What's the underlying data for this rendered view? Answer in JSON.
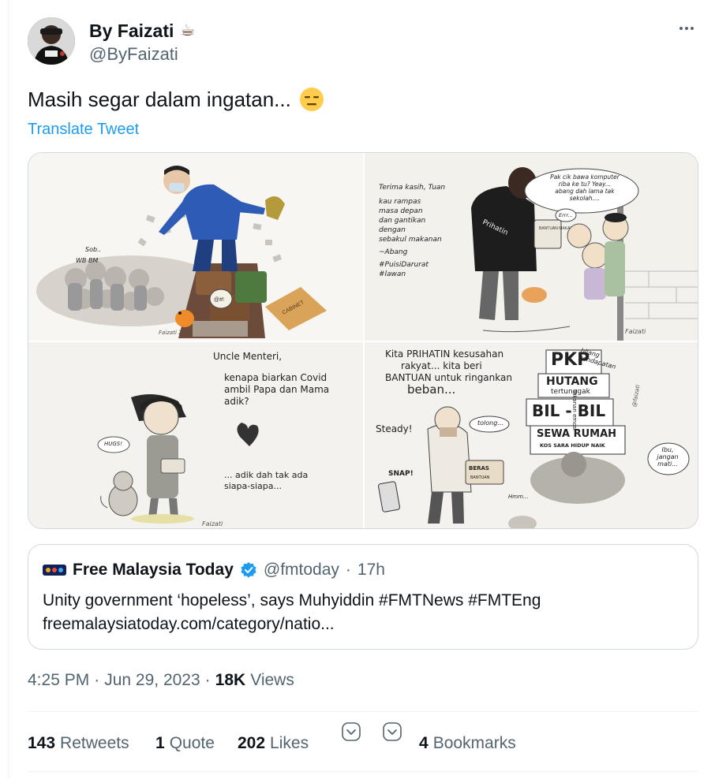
{
  "author": {
    "display_name": "By Faizati",
    "name_emoji": "☕",
    "handle": "@ByFaizati"
  },
  "tweet": {
    "text": "Masih segar dalam ingatan...",
    "emoji": "😑",
    "translate_label": "Translate Tweet"
  },
  "comics": {
    "panel1": {
      "caption_left": "Sob..",
      "caption_left2": "WB BM",
      "sound": "@#!",
      "box1": "CABINET",
      "box2": "MENI PERMINTAAN",
      "signature": "Faizati 2021"
    },
    "panel2": {
      "poem": [
        "Terima kasih, Tuan",
        "kau rampas",
        "masa depan",
        "dan gantikan",
        "dengan",
        "sebakul makanan"
      ],
      "author": "~Abang",
      "hashtags": [
        "#PuisiDarurat",
        "#lawan"
      ],
      "bubble": [
        "Pak cik bawa komputer",
        "riba ke tu? Yeay...",
        "abang dah lama tak",
        "sekolah...."
      ],
      "err": "Errr...",
      "vest": "Prihatin",
      "bag": "BANTUAN MAKANAN",
      "signature": "Faizati"
    },
    "panel3": {
      "lines": [
        "Uncle Menteri,",
        "kenapa biarkan Covid",
        "ambil Papa dan Mama",
        "adik?"
      ],
      "bottom": [
        "... adik dah tak ada",
        "siapa-siapa..."
      ],
      "hugs": "HUGS!",
      "signature": "Faizati"
    },
    "panel4": {
      "top": [
        "Kita PRIHATIN kesusahan",
        "rakyat... kita beri",
        "BANTUAN untuk ringankan",
        "beban..."
      ],
      "steady": "Steady!",
      "tolong": "tolong...",
      "pkp": "PKP",
      "pkp_note": [
        "hilang",
        "pendapatan"
      ],
      "hutang": "HUTANG",
      "hutang_note": "tertunggak",
      "bil": "BIL - BIL",
      "sewa": "SEWA RUMAH",
      "kos": "KOS SARA HIDUP NAIK",
      "emosi": "Tekanan emosi",
      "ibu": [
        "Ibu,",
        "jangan",
        "mati..."
      ],
      "snap": "SNAP!",
      "beras": "BERAS",
      "bantuan": "BANTUAN",
      "hmm": "Hmm...",
      "signature": "@faizati"
    }
  },
  "quote": {
    "name": "Free Malaysia Today",
    "handle": "@fmtoday",
    "separator": "·",
    "time": "17h",
    "text": "Unity government ‘hopeless’, says Muhyiddin #FMTNews #FMTEng",
    "link": "freemalaysiatoday.com/category/natio..."
  },
  "meta": {
    "time": "4:25 PM",
    "sep1": "·",
    "date": "Jun 29, 2023",
    "sep2": "·",
    "views_count": "18K",
    "views_label": "Views"
  },
  "stats": {
    "retweets_count": "143",
    "retweets_label": "Retweets",
    "quotes_count": "1",
    "quotes_label": "Quote",
    "likes_count": "202",
    "likes_label": "Likes",
    "bookmarks_count": "4",
    "bookmarks_label": "Bookmarks"
  },
  "colors": {
    "link_blue": "#1d9bf0",
    "secondary_text": "#536471",
    "border": "#cfd9de",
    "verified_blue": "#1d9bf0"
  }
}
